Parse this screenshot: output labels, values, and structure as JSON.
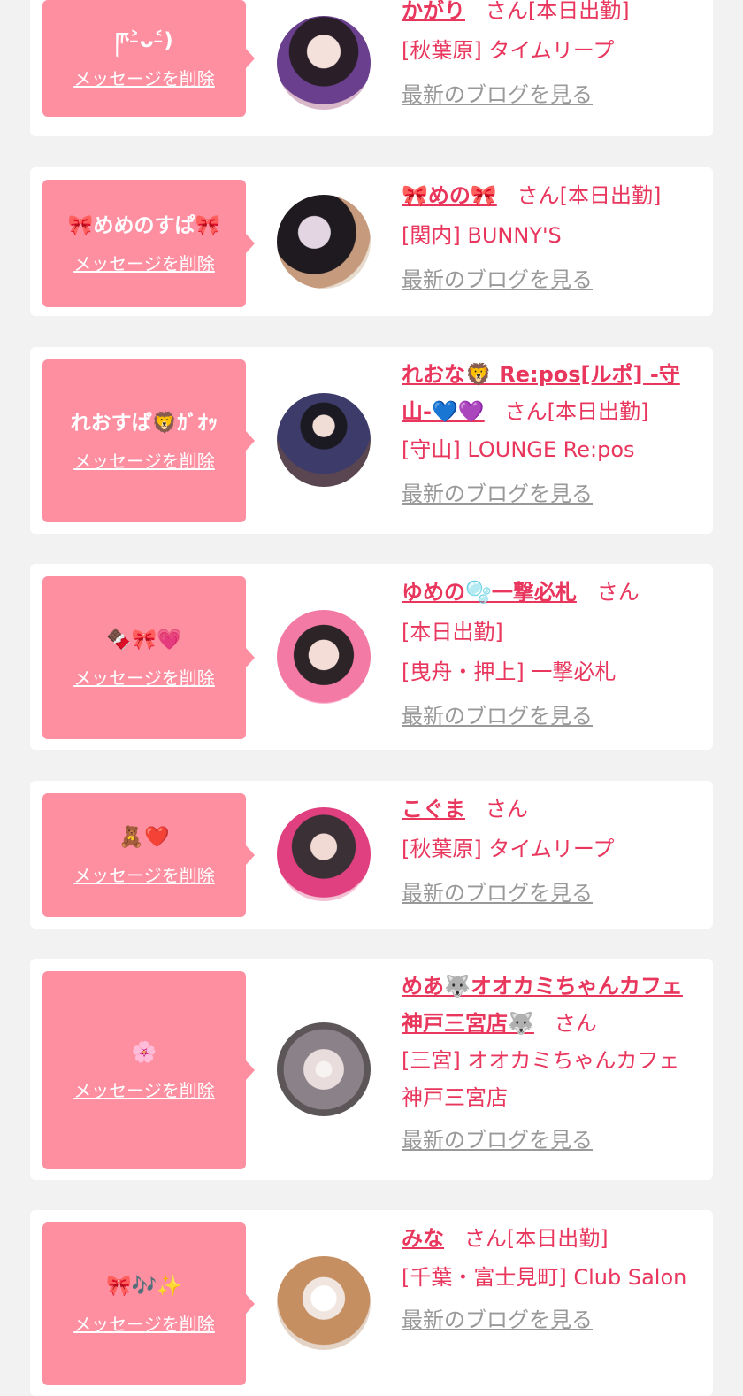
{
  "delete_label": "メッセージを削除",
  "blog_label": "最新のブログを見る",
  "colors": {
    "page_bg": "#f2f2f3",
    "bubble": "#fd8fa1",
    "accent": "#e8365d",
    "muted": "#999999"
  },
  "cards": [
    {
      "message": "ཫ˃̵ᴗ˂̵)",
      "name": "かがり",
      "suffix": "さん[本日出勤]",
      "shop": "[秋葉原] タイムリープ",
      "avatar_desc": "girl-dark-hair-purple"
    },
    {
      "message": "🎀めめのすぱ🎀",
      "name": "🎀めの🎀",
      "suffix": "さん[本日出勤]",
      "shop": "[関内] BUNNY'S",
      "avatar_desc": "girl-dark-hair-drink"
    },
    {
      "message": "れおすぱ🦁ｶﾞｵｯ",
      "name": "れおな🦁 Re:pos[ルポ] -守山-💙💜",
      "suffix": "さん[本日出勤]",
      "shop": "[守山] LOUNGE Re:pos",
      "avatar_desc": "girl-dress-dark"
    },
    {
      "message": "🍫🎀💗",
      "name": "ゆめの🫧一撃必札",
      "suffix": "さん",
      "status": "[本日出勤]",
      "shop": "[曳舟・押上] 一撃必札",
      "avatar_desc": "girl-pink-ears"
    },
    {
      "message": "🧸❤️",
      "name": "こぐま",
      "suffix": "さん",
      "shop": "[秋葉原] タイムリープ",
      "avatar_desc": "girl-pink-kimono"
    },
    {
      "message": "🌸",
      "name": "めあ🐺オオカミちゃんカフェ神戸三宮店🐺",
      "suffix": "さん",
      "shop": "[三宮] オオカミちゃんカフェ神戸三宮店",
      "avatar_desc": "girl-grey-hair"
    },
    {
      "message": "🎀🎶✨",
      "name": "みな",
      "suffix": "さん[本日出勤]",
      "shop": "[千葉・富士見町] Club Salon",
      "avatar_desc": "girl-heart-face"
    }
  ]
}
